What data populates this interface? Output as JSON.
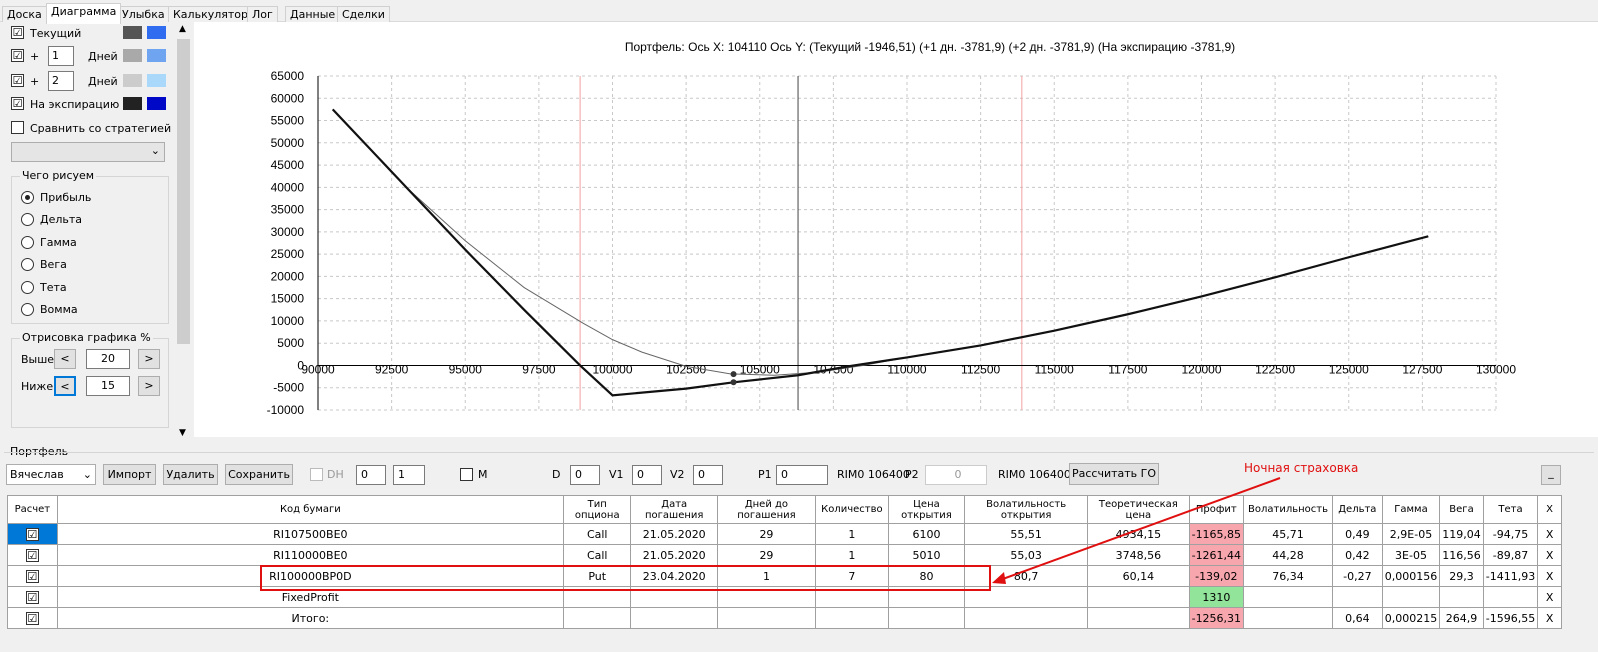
{
  "tabs": [
    {
      "label": "Доска"
    },
    {
      "label": "Диаграмма"
    },
    {
      "label": "Улыбка"
    },
    {
      "label": "Калькулятор"
    },
    {
      "label": "Лог"
    },
    {
      "label": "Данные"
    },
    {
      "label": "Сделки"
    }
  ],
  "left": {
    "current": {
      "label": "Текущий",
      "checked": "☑"
    },
    "plus1": {
      "prefix": "+",
      "value": "1",
      "days": "Дней",
      "checked": "☑"
    },
    "plus2": {
      "prefix": "+",
      "value": "2",
      "days": "Дней",
      "checked": "☑"
    },
    "expiry": {
      "label": "На экспирацию",
      "checked": "☑"
    },
    "compare": {
      "label": "Сравнить со стратегией",
      "checked": ""
    },
    "colors": {
      "current": [
        "#555555",
        "#2f6cf0"
      ],
      "plus1": [
        "#a9a9a9",
        "#6fa5f0"
      ],
      "plus2": [
        "#cccccc",
        "#aad8fb"
      ],
      "expiry": [
        "#222222",
        "#0008c8"
      ]
    },
    "what_group": {
      "title": "Чего рисуем",
      "options": [
        {
          "label": "Прибыль",
          "selected": true
        },
        {
          "label": "Дельта",
          "selected": false
        },
        {
          "label": "Гамма",
          "selected": false
        },
        {
          "label": "Вега",
          "selected": false
        },
        {
          "label": "Тета",
          "selected": false
        },
        {
          "label": "Вомма",
          "selected": false
        }
      ]
    },
    "draw_group": {
      "title": "Отрисовка графика %",
      "above_label": "Выше",
      "above_value": "20",
      "below_label": "Ниже",
      "below_value": "15",
      "dec": "<",
      "inc": ">"
    }
  },
  "chart_data": {
    "type": "line",
    "title": "Портфель: Ось X:  104110  Ось Y:   (Текущий -1946,51)  (+1 дн. -3781,9)  (+2 дн. -3781,9)  (На экспирацию -3781,9)",
    "xlim": [
      90000,
      130000
    ],
    "ylim": [
      -10000,
      65000
    ],
    "xticks": [
      90000,
      92500,
      95000,
      97500,
      100000,
      102500,
      105000,
      107500,
      110000,
      112500,
      115000,
      117500,
      120000,
      122500,
      125000,
      127500,
      130000
    ],
    "yticks": [
      -10000,
      -5000,
      0,
      5000,
      10000,
      15000,
      20000,
      25000,
      30000,
      35000,
      40000,
      45000,
      50000,
      55000,
      60000,
      65000
    ],
    "vlines": [
      {
        "x": 98900,
        "color": "#f4a0a0"
      },
      {
        "x": 106300,
        "color": "#444444"
      },
      {
        "x": 113900,
        "color": "#f4a0a0"
      }
    ],
    "series": [
      {
        "color": "#666666",
        "width": 1,
        "x": [
          90500,
          93000,
          95000,
          97000,
          99000,
          100000,
          101000,
          102500,
          104000,
          105500,
          107000,
          108500,
          110000,
          112500,
          115000,
          117500,
          120000,
          122500,
          125000,
          127700
        ],
        "y": [
          57500,
          40000,
          28000,
          17500,
          9500,
          5800,
          3000,
          -200,
          -1900,
          -2200,
          -1500,
          0,
          1800,
          4500,
          7800,
          11500,
          15500,
          19800,
          24300,
          29000
        ]
      },
      {
        "color": "#111111",
        "width": 2.2,
        "x": [
          90500,
          93000,
          95000,
          97000,
          98900,
          100000,
          102500,
          104110,
          106300,
          108000,
          110000,
          112500,
          115000,
          117500,
          120000,
          122500,
          125000,
          127700
        ],
        "y": [
          57500,
          40000,
          26000,
          12500,
          0,
          -6700,
          -5200,
          -3782,
          -2200,
          -200,
          1800,
          4500,
          7800,
          11500,
          15500,
          19800,
          24300,
          29000
        ]
      }
    ],
    "markers": [
      {
        "x": 104110,
        "y": -1946.51
      },
      {
        "x": 104110,
        "y": -3781.9
      }
    ]
  },
  "portfolio": {
    "title": "Портфель",
    "user": "Вячеслав",
    "import": "Импорт",
    "delete": "Удалить",
    "save": "Сохранить",
    "dh": "DH",
    "s1": "0",
    "s2": "1",
    "m": "M",
    "d_label": "D",
    "d_val": "0",
    "v1_label": "V1",
    "v1_val": "0",
    "v2_label": "V2",
    "v2_val": "0",
    "p1_label": "P1",
    "p1_val": "0",
    "rim1": "RIM0 106400",
    "p2_label": "P2",
    "p2_val": "0",
    "rim2": "RIM0 106400",
    "calc_go": "Рассчитать ГО",
    "min": "_"
  },
  "annotation": "Ночная страховка",
  "table": {
    "headers": [
      "Расчет",
      "Код бумаги",
      "Тип опциона",
      "Дата погашения",
      "Дней до погашения",
      "Количество",
      "Цена открытия",
      "Волатильность открытия",
      "Теоретическая цена",
      "Профит",
      "Волатильность",
      "Дельта",
      "Гамма",
      "Вега",
      "Тета",
      "X"
    ],
    "rows": [
      {
        "check": "☑",
        "code": "RI107500BE0",
        "type": "Call",
        "date": "21.05.2020",
        "days": "29",
        "qty": "1",
        "price": "6100",
        "vol_open": "55,51",
        "theor": "4934,15",
        "profit": "-1165,85",
        "profit_class": "red",
        "vol": "45,71",
        "delta": "0,49",
        "gamma": "2,9E-05",
        "vega": "119,04",
        "theta": "-94,75",
        "x": "X"
      },
      {
        "check": "☑",
        "code": "RI110000BE0",
        "type": "Call",
        "date": "21.05.2020",
        "days": "29",
        "qty": "1",
        "price": "5010",
        "vol_open": "55,03",
        "theor": "3748,56",
        "profit": "-1261,44",
        "profit_class": "red",
        "vol": "44,28",
        "delta": "0,42",
        "gamma": "3E-05",
        "vega": "116,56",
        "theta": "-89,87",
        "x": "X"
      },
      {
        "check": "☑",
        "code": "RI100000BP0D",
        "type": "Put",
        "date": "23.04.2020",
        "days": "1",
        "qty": "7",
        "price": "80",
        "vol_open": "80,7",
        "theor": "60,14",
        "profit": "-139,02",
        "profit_class": "red",
        "vol": "76,34",
        "delta": "-0,27",
        "gamma": "0,000156",
        "vega": "29,3",
        "theta": "-1411,93",
        "x": "X"
      },
      {
        "check": "☑",
        "code": "FixedProfit",
        "type": "",
        "date": "",
        "days": "",
        "qty": "",
        "price": "",
        "vol_open": "",
        "theor": "",
        "profit": "1310",
        "profit_class": "green",
        "vol": "",
        "delta": "",
        "gamma": "",
        "vega": "",
        "theta": "",
        "x": "X"
      },
      {
        "check": "☑",
        "code": "Итого:",
        "type": "",
        "date": "",
        "days": "",
        "qty": "",
        "price": "",
        "vol_open": "",
        "theor": "",
        "profit": "-1256,31",
        "profit_class": "red",
        "vol": "",
        "delta": "0,64",
        "gamma": "0,000215",
        "vega": "264,9",
        "theta": "-1596,55",
        "x": "X"
      }
    ]
  }
}
